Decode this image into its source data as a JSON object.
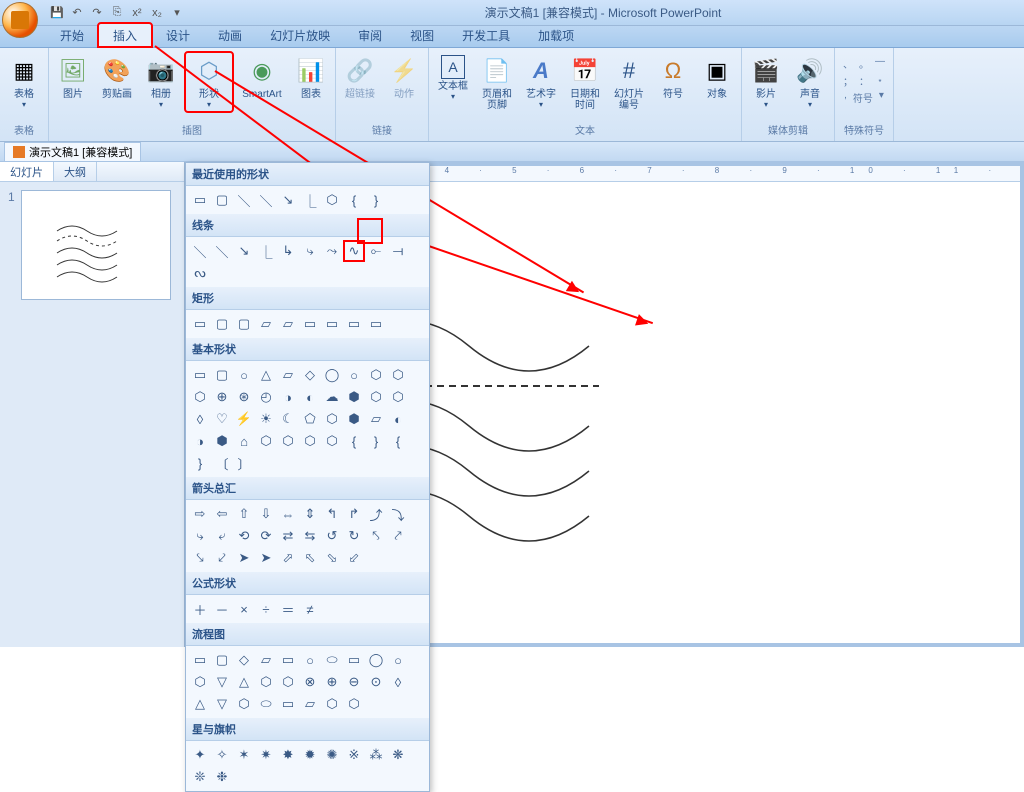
{
  "title": "演示文稿1 [兼容模式] - Microsoft PowerPoint",
  "tabs": {
    "start": "开始",
    "insert": "插入",
    "design": "设计",
    "anim": "动画",
    "show": "幻灯片放映",
    "review": "审阅",
    "view": "视图",
    "dev": "开发工具",
    "addin": "加载项"
  },
  "ribbon": {
    "table": "表格",
    "tables": "表格",
    "pic": "图片",
    "clip": "剪贴画",
    "album": "相册",
    "shape": "形状",
    "smartart": "SmartArt",
    "chart": "图表",
    "illus": "插图",
    "link": "超链接",
    "action": "动作",
    "links": "链接",
    "textbox": "文本框",
    "header": "页眉和页脚",
    "wordart": "艺术字",
    "datetime": "日期和时间",
    "slidenum": "幻灯片编号",
    "symbol": "符号",
    "object": "对象",
    "text": "文本",
    "movie": "影片",
    "sound": "声音",
    "media": "媒体剪辑",
    "special": "特殊符号",
    "symlabel": "符号"
  },
  "doc": "演示文稿1 [兼容模式]",
  "pane": {
    "slides": "幻灯片",
    "outline": "大纲"
  },
  "gallery": {
    "recent": "最近使用的形状",
    "lines": "线条",
    "rects": "矩形",
    "basic": "基本形状",
    "arrows": "箭头总汇",
    "equation": "公式形状",
    "flowchart": "流程图",
    "stars": "星与旗帜"
  },
  "shapes": {
    "recent": [
      "▭",
      "▢",
      "＼",
      "＼",
      "↘",
      "⎿",
      "⬡",
      "{",
      "}"
    ],
    "lines": [
      "＼",
      "＼",
      "↘",
      "⎿",
      "↳",
      "⤷",
      "⤳",
      "∿",
      "⟜",
      "⟞",
      "ᔓ"
    ],
    "rects": [
      "▭",
      "▢",
      "▢",
      "▱",
      "▱",
      "▭",
      "▭",
      "▭",
      "▭"
    ],
    "basic": [
      "▭",
      "▢",
      "○",
      "△",
      "▱",
      "◇",
      "◯",
      "○",
      "⬡",
      "⬡",
      "⬡",
      "⊕",
      "⊛",
      "◴",
      "◑",
      "◐",
      "☁",
      "⬢",
      "⬡",
      "⬡",
      "◊",
      "♡",
      "⚡",
      "☀",
      "☾",
      "⬠",
      "⬡",
      "⬢",
      "▱",
      "◐",
      "◑",
      "⬢",
      "⌂",
      "⬡",
      "⬡",
      "⬡",
      "⬡",
      "{",
      "}",
      "{",
      "}",
      "〔",
      "〕"
    ],
    "arrows": [
      "⇨",
      "⇦",
      "⇧",
      "⇩",
      "⇔",
      "⇕",
      "↰",
      "↱",
      "⤴",
      "⤵",
      "⤷",
      "⤶",
      "⟲",
      "⟳",
      "⇄",
      "⇆",
      "↺",
      "↻",
      "⤣",
      "⤤",
      "⤥",
      "⤦",
      "➤",
      "➤",
      "⬀",
      "⬁",
      "⬂",
      "⬃"
    ],
    "equation": [
      "＋",
      "－",
      "×",
      "÷",
      "＝",
      "≠"
    ],
    "flowchart": [
      "▭",
      "▢",
      "◇",
      "▱",
      "▭",
      "○",
      "⬭",
      "▭",
      "◯",
      "○",
      "⬡",
      "▽",
      "△",
      "⬡",
      "⬡",
      "⊗",
      "⊕",
      "⊖",
      "⊙",
      "◊",
      "△",
      "▽",
      "⬡",
      "⬭",
      "▭",
      "▱",
      "⬡",
      "⬡"
    ],
    "stars": [
      "✦",
      "✧",
      "✶",
      "✷",
      "✸",
      "✹",
      "✺",
      "※",
      "⁂",
      "❋",
      "❊",
      "❉"
    ]
  }
}
